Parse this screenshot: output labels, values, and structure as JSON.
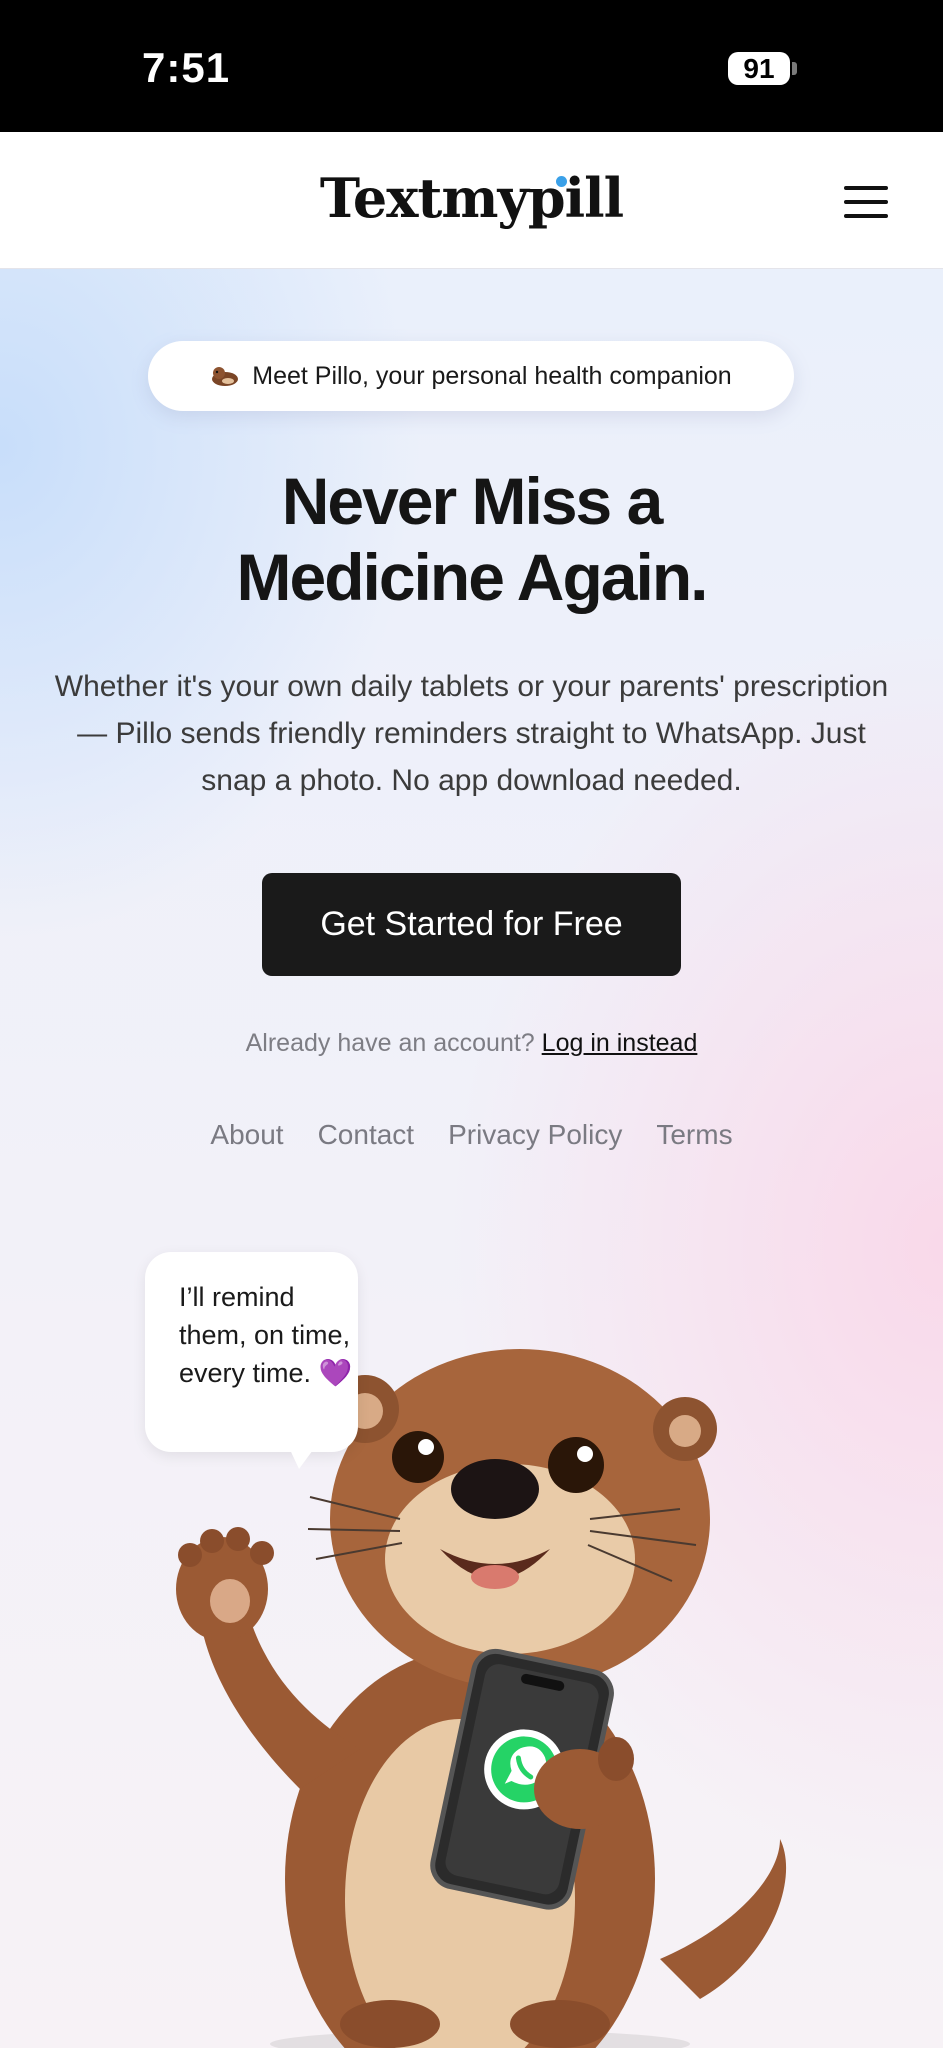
{
  "status_bar": {
    "time": "7:51",
    "battery": "91"
  },
  "navbar": {
    "logo": "Textmypill",
    "menu_icon": "hamburger-icon"
  },
  "hero": {
    "badge": "Meet Pillo, your personal health companion",
    "title_line1": "Never Miss a",
    "title_line2": "Medicine Again.",
    "subtitle": "Whether it's your own daily tablets or your parents' prescription — Pillo sends friendly reminders straight to WhatsApp. Just snap a photo. No app download needed.",
    "cta_label": "Get Started for Free",
    "login_prompt": "Already have an account?",
    "login_link": "Log in instead"
  },
  "footer_links": [
    "About",
    "Contact",
    "Privacy Policy",
    "Terms"
  ],
  "mascot": {
    "speech": "I’ll remind them, on time, every time. 💜",
    "phone_app_icon": "whatsapp-icon"
  },
  "colors": {
    "cta_bg": "#1a1a1a",
    "whatsapp_green": "#25d366",
    "otter_fur": "#9b5a34",
    "otter_belly": "#e8c9a5"
  }
}
